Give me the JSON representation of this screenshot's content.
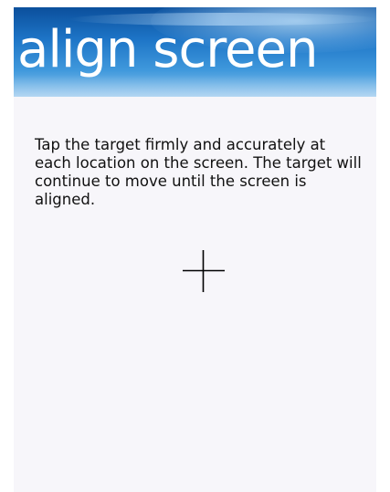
{
  "header": {
    "title": "align screen"
  },
  "main": {
    "instructions": "Tap the target firmly and accurately at each location on the screen. The target will continue to move until the screen is aligned.",
    "target_icon": "crosshair-icon"
  },
  "colors": {
    "header_gradient_top": "#0b4f9c",
    "header_gradient_bottom": "#8fc6ee",
    "title_text": "#ffffff",
    "background": "#f7f6fa",
    "body_text": "#111111",
    "target": "#000000"
  }
}
